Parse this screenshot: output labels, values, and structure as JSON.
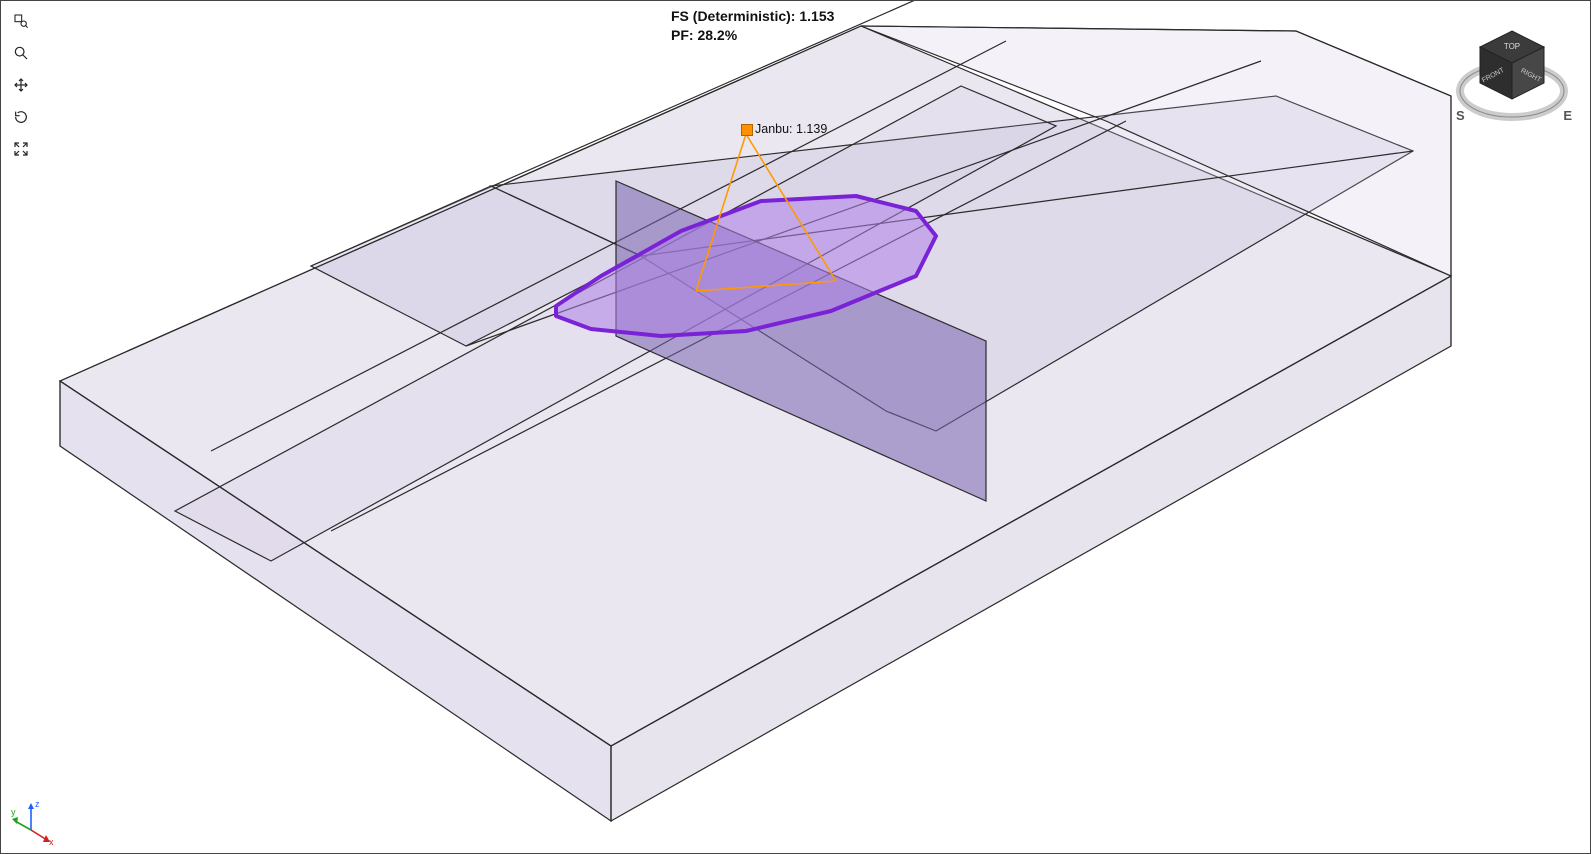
{
  "results": {
    "fs_label": "FS (Deterministic): 1.153",
    "pf_label": "PF: 28.2%"
  },
  "annotation": {
    "text": "Janbu: 1.139"
  },
  "viewcube": {
    "face_top": "TOP",
    "face_front": "FRONT",
    "face_right": "RIGHT",
    "compass_s": "S",
    "compass_e": "E"
  },
  "axis_triad": {
    "x": "x",
    "y": "y",
    "z": "z"
  },
  "toolbar": {
    "zoom_window": "zoom-window",
    "zoom": "zoom",
    "pan": "pan",
    "rotate": "rotate",
    "fit": "zoom-extents"
  },
  "colors": {
    "geometry_fill": "#d7cfe2",
    "geometry_fill_dark": "#b8aed0",
    "section_fill": "#9a89c9",
    "slip_outline": "#8a2be2",
    "slip_fill": "#b88ae8",
    "annotation_line": "#ff9a00",
    "edge": "#2b2b2b"
  }
}
